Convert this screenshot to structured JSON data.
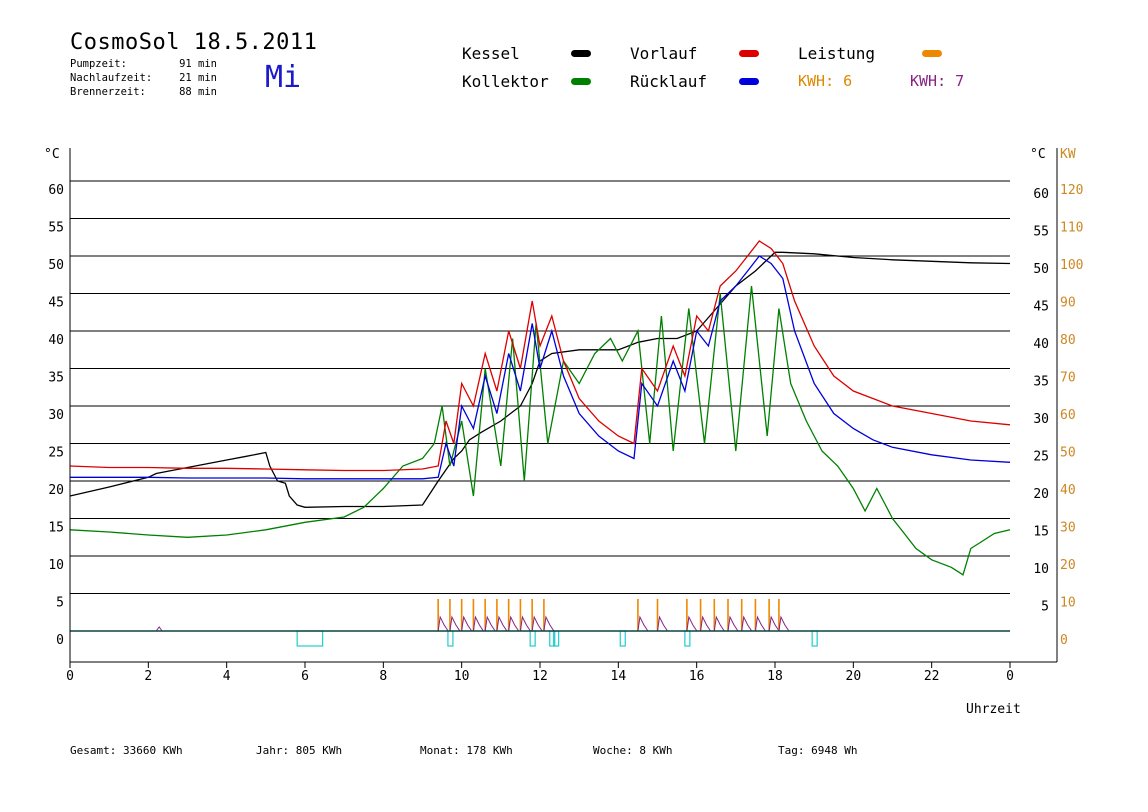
{
  "header": {
    "title": "CosmoSol 18.5.2011",
    "day": "Mi",
    "stats": [
      {
        "label": "Pumpzeit:",
        "value": "91 min"
      },
      {
        "label": "Nachlaufzeit:",
        "value": "21 min"
      },
      {
        "label": "Brennerzeit:",
        "value": "88 min"
      }
    ]
  },
  "legend": {
    "kessel": {
      "label": "Kessel",
      "color": "#000000"
    },
    "kollektor": {
      "label": "Kollektor",
      "color": "#008000"
    },
    "vorlauf": {
      "label": "Vorlauf",
      "color": "#dd0000"
    },
    "ruecklauf": {
      "label": "Rücklauf",
      "color": "#0000dd"
    },
    "leistung": {
      "label": "Leistung",
      "color": "#ee8800"
    },
    "kwh1": {
      "text": "KWH: 6",
      "color": "#dd8800"
    },
    "kwh2": {
      "text": "KWH: 7",
      "color": "#882288"
    }
  },
  "footer": {
    "gesamt": "Gesamt:  33660 KWh",
    "jahr": "Jahr:   805 KWh",
    "monat": "Monat:   178 KWh",
    "woche": "Woche:      8 KWh",
    "tag": "Tag:   6948 Wh"
  },
  "chart_data": {
    "type": "line",
    "xlabel": "Uhrzeit",
    "ylabel_left": "°C",
    "ylabel_right_temp": "°C",
    "ylabel_right_power": "KW",
    "xlim": [
      0,
      24
    ],
    "ylim": [
      -4,
      64
    ],
    "x_ticks": [
      "0",
      "2",
      "4",
      "6",
      "8",
      "10",
      "12",
      "14",
      "16",
      "18",
      "20",
      "22",
      "0"
    ],
    "y_ticks_left": [
      "0",
      "5",
      "10",
      "15",
      "20",
      "25",
      "30",
      "35",
      "40",
      "45",
      "50",
      "55",
      "60"
    ],
    "y_ticks_right_temp": [
      "5",
      "10",
      "15",
      "20",
      "25",
      "30",
      "35",
      "40",
      "45",
      "50",
      "55",
      "60"
    ],
    "y_ticks_right_power": [
      "0",
      "10",
      "20",
      "30",
      "40",
      "50",
      "60",
      "70",
      "80",
      "90",
      "100",
      "110",
      "120"
    ],
    "grid": true,
    "series": [
      {
        "name": "Kessel",
        "color": "#000000",
        "x": [
          0,
          1,
          2,
          2.2,
          3,
          4,
          4.5,
          5,
          5.1,
          5.3,
          5.5,
          5.6,
          5.8,
          6,
          7,
          8,
          9,
          9.4,
          9.6,
          9.8,
          10,
          10.2,
          10.5,
          11,
          11.5,
          11.8,
          12,
          12.3,
          13,
          13.5,
          14,
          14.5,
          15,
          15.5,
          16,
          16.5,
          17,
          17.5,
          18,
          18.2,
          19,
          20,
          21,
          22,
          23,
          24
        ],
        "y": [
          18,
          19.2,
          20.5,
          21,
          21.8,
          22.8,
          23.3,
          23.8,
          22,
          20,
          19.7,
          18,
          16.8,
          16.5,
          16.6,
          16.6,
          16.8,
          20,
          21.5,
          23,
          24,
          25.5,
          26.5,
          28,
          30,
          33,
          36,
          37,
          37.5,
          37.5,
          37.5,
          38.5,
          39,
          39,
          40,
          43,
          46,
          48,
          50.5,
          50.5,
          50.3,
          49.8,
          49.5,
          49.3,
          49.1,
          49
        ]
      },
      {
        "name": "Kollektor",
        "color": "#008000",
        "x": [
          0,
          1,
          2,
          3,
          4,
          5,
          6,
          7,
          7.5,
          8,
          8.5,
          9,
          9.3,
          9.5,
          9.7,
          10,
          10.3,
          10.6,
          11,
          11.3,
          11.6,
          11.9,
          12.2,
          12.6,
          13,
          13.4,
          13.8,
          14.1,
          14.5,
          14.8,
          15.1,
          15.4,
          15.8,
          16.2,
          16.6,
          17,
          17.4,
          17.8,
          18.1,
          18.4,
          18.8,
          19.2,
          19.6,
          20,
          20.3,
          20.6,
          20.8,
          21,
          21.3,
          21.6,
          22,
          22.5,
          22.8,
          23,
          23.3,
          23.6,
          24
        ],
        "y": [
          13.5,
          13.2,
          12.8,
          12.5,
          12.8,
          13.5,
          14.5,
          15.2,
          16.5,
          19,
          22,
          23,
          25,
          30,
          22,
          28,
          18,
          35,
          22,
          39,
          20,
          41,
          25,
          36,
          33,
          37,
          39,
          36,
          40,
          25,
          42,
          24,
          43,
          25,
          45,
          24,
          46,
          26,
          43,
          33,
          28,
          24,
          22,
          19,
          16,
          19,
          17,
          15,
          13,
          11,
          9.5,
          8.5,
          7.5,
          11,
          12,
          13,
          13.5
        ]
      },
      {
        "name": "Vorlauf",
        "color": "#dd0000",
        "x": [
          0,
          1,
          2,
          3,
          4,
          5,
          6,
          7,
          8,
          9,
          9.4,
          9.6,
          9.8,
          10,
          10.3,
          10.6,
          10.9,
          11.2,
          11.5,
          11.8,
          12,
          12.3,
          12.6,
          13,
          13.5,
          14,
          14.4,
          14.6,
          15,
          15.4,
          15.7,
          16,
          16.3,
          16.6,
          17,
          17.3,
          17.6,
          17.9,
          18.2,
          18.5,
          19,
          19.5,
          20,
          20.5,
          21,
          22,
          23,
          24
        ],
        "y": [
          22,
          21.8,
          21.8,
          21.7,
          21.7,
          21.6,
          21.5,
          21.4,
          21.4,
          21.6,
          22,
          28,
          25,
          33,
          30,
          37,
          32,
          40,
          35,
          44,
          38,
          42,
          36,
          31,
          28,
          26,
          25,
          35,
          32,
          38,
          34,
          42,
          40,
          46,
          48,
          50,
          52,
          51,
          49,
          44,
          38,
          34,
          32,
          31,
          30,
          29,
          28,
          27.5
        ]
      },
      {
        "name": "Rücklauf",
        "color": "#0000dd",
        "x": [
          0,
          1,
          2,
          3,
          4,
          5,
          6,
          7,
          8,
          9,
          9.4,
          9.6,
          9.8,
          10,
          10.3,
          10.6,
          10.9,
          11.2,
          11.5,
          11.8,
          12,
          12.3,
          12.6,
          13,
          13.5,
          14,
          14.4,
          14.6,
          15,
          15.4,
          15.7,
          16,
          16.3,
          16.6,
          17,
          17.3,
          17.6,
          17.9,
          18.2,
          18.5,
          19,
          19.5,
          20,
          20.5,
          21,
          22,
          23,
          24
        ],
        "y": [
          20.5,
          20.5,
          20.5,
          20.4,
          20.4,
          20.4,
          20.3,
          20.3,
          20.3,
          20.3,
          20.5,
          25,
          22,
          30,
          27,
          34,
          29,
          37,
          32,
          41,
          35,
          40,
          34,
          29,
          26,
          24,
          23,
          33,
          30,
          36,
          32,
          40,
          38,
          44,
          46,
          48,
          50,
          49,
          47,
          40,
          33,
          29,
          27,
          25.5,
          24.5,
          23.5,
          22.8,
          22.5
        ]
      }
    ],
    "power_bursts": [
      9.4,
      9.7,
      10,
      10.3,
      10.6,
      10.9,
      11.2,
      11.5,
      11.8,
      12.1,
      14.5,
      15,
      15.75,
      16.1,
      16.45,
      16.8,
      17.15,
      17.5,
      17.85,
      18.1
    ],
    "pump_markers": [
      9.7,
      11.8,
      12.3,
      12.4,
      14.1,
      15.75,
      19.0
    ]
  }
}
